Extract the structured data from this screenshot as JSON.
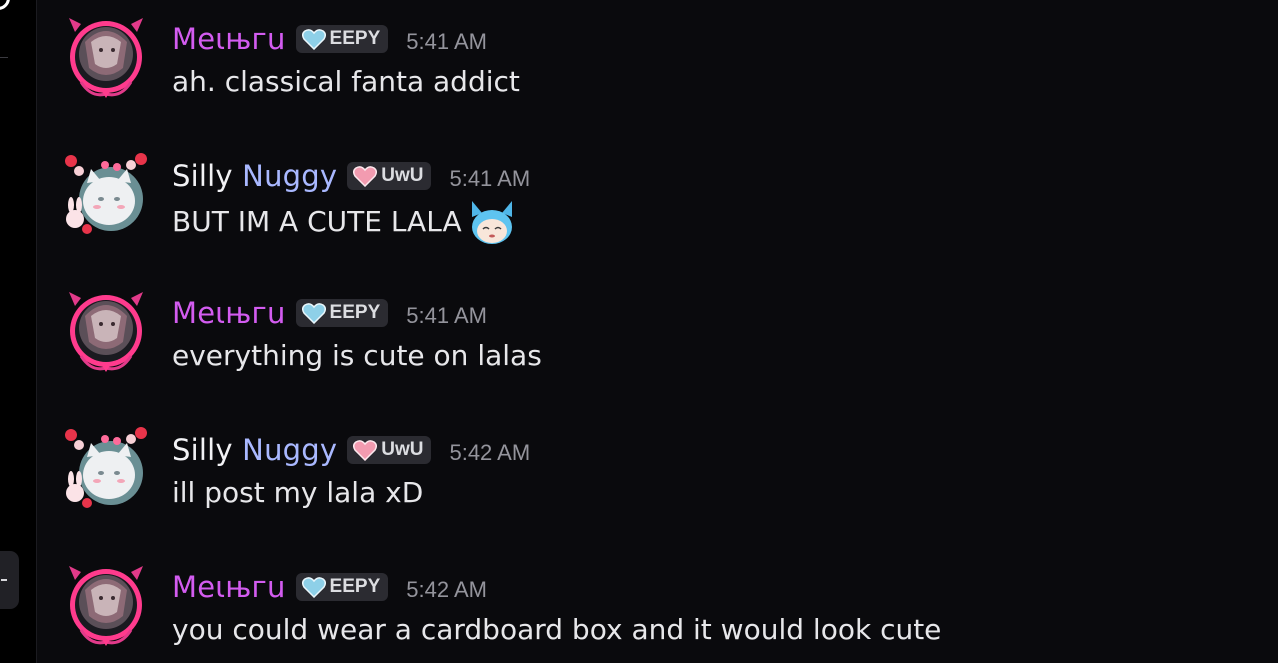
{
  "colors": {
    "background": "#0a0a0d",
    "meiru_name": "#d35cf0",
    "silly_name": "#f2f2f5",
    "nuggy_name": "#a9b8ff",
    "tag_bg": "#2b2b31",
    "timestamp": "#94949c",
    "message_text": "#e7e7ea"
  },
  "messages": [
    {
      "author_part1": "Mеιњгu",
      "tag": "EEPY",
      "tag_icon": "blue-heart-icon",
      "time": "5:41 AM",
      "text": "ah. classical fanta addict"
    },
    {
      "author_part1": "Silly",
      "author_part2": "Nuggy",
      "tag": "UwU",
      "tag_icon": "pink-heart-icon",
      "time": "5:41 AM",
      "text": "BUT IM A CUTE LALA",
      "emoji": "catgirl-emoji"
    },
    {
      "author_part1": "Mеιњгu",
      "tag": "EEPY",
      "tag_icon": "blue-heart-icon",
      "time": "5:41 AM",
      "text": "everything is cute on lalas"
    },
    {
      "author_part1": "Silly",
      "author_part2": "Nuggy",
      "tag": "UwU",
      "tag_icon": "pink-heart-icon",
      "time": "5:42 AM",
      "text": "ill post my lala xD"
    },
    {
      "author_part1": "Mеιњгu",
      "tag": "EEPY",
      "tag_icon": "blue-heart-icon",
      "time": "5:42 AM",
      "text": "you could wear a cardboard box and it would look cute"
    }
  ]
}
